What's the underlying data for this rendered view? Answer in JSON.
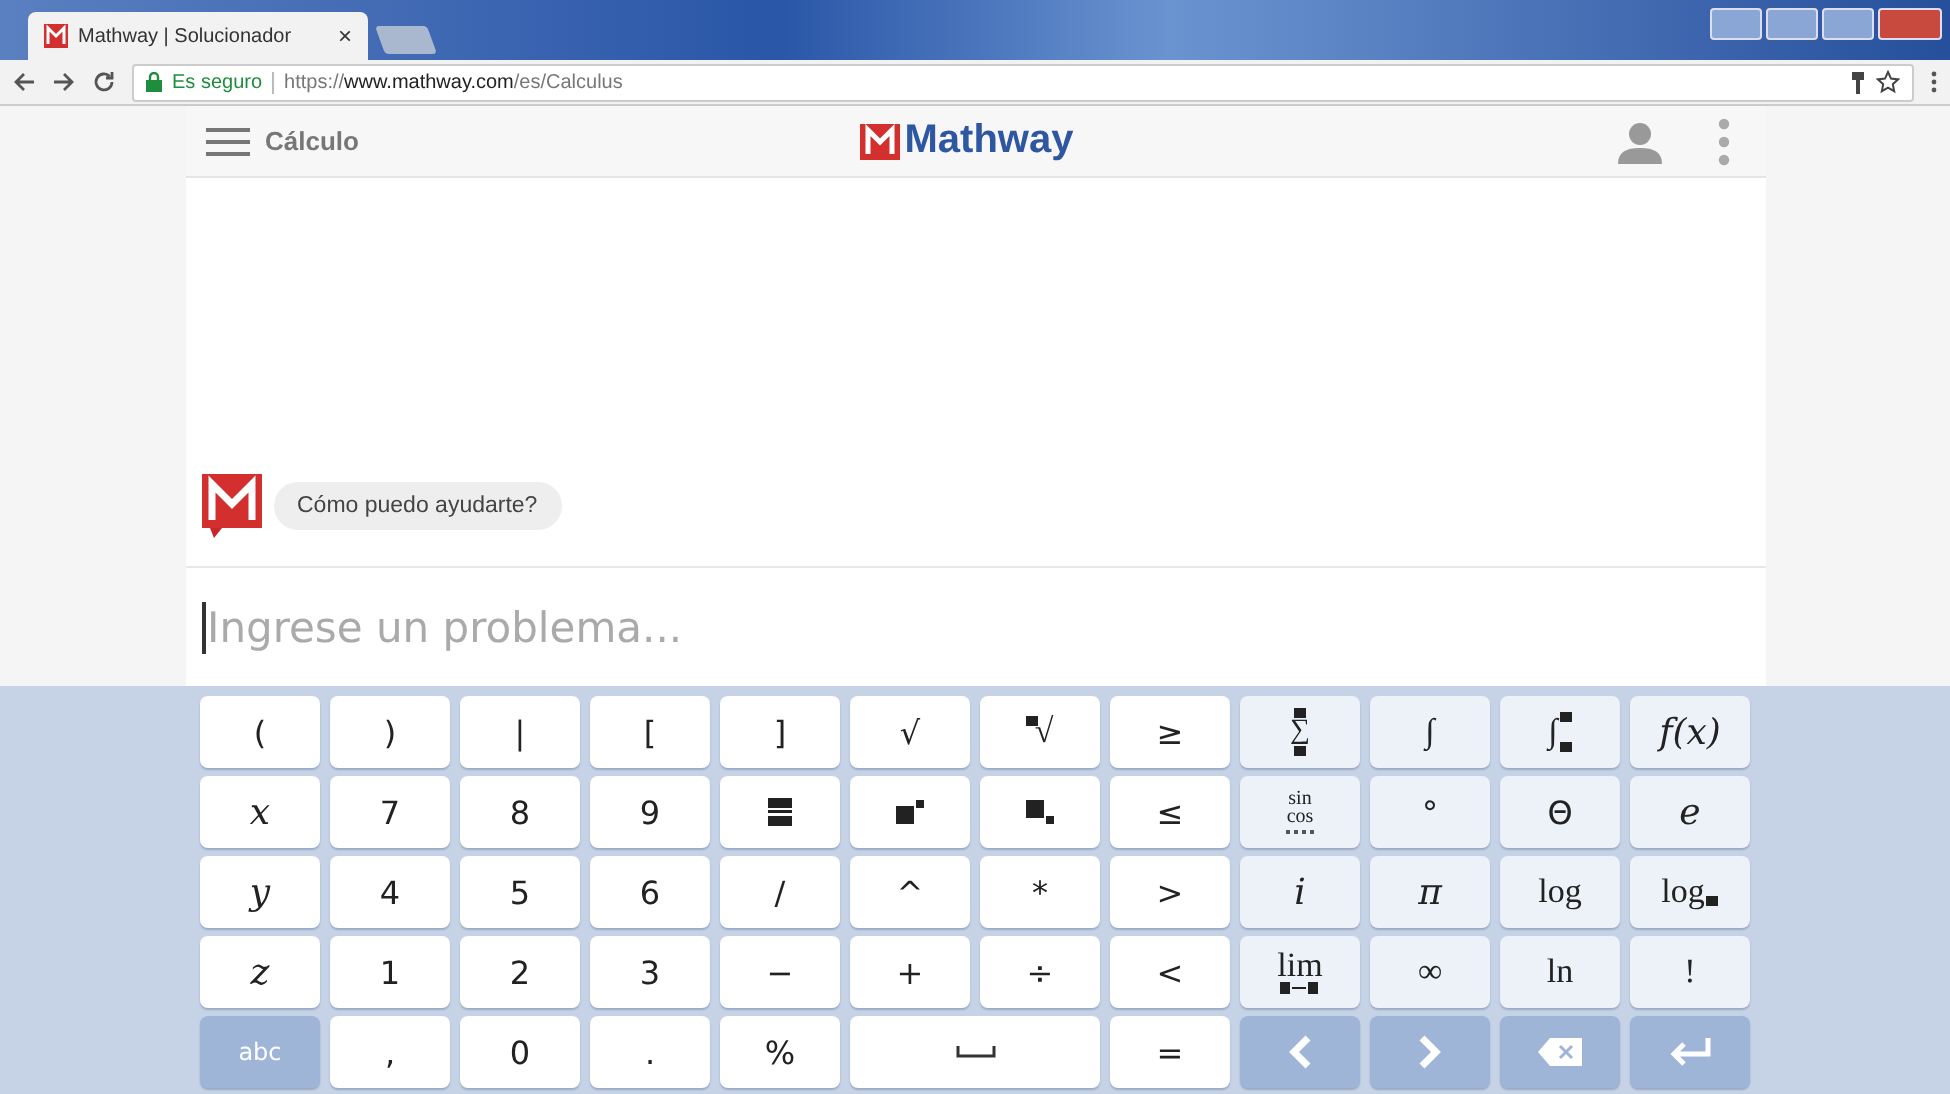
{
  "browser": {
    "tab": {
      "title": "Mathway | Solucionador",
      "close": "×"
    },
    "security": "Es seguro",
    "url": {
      "scheme": "https://",
      "host": "www.mathway.com",
      "path": "/es/Calculus"
    }
  },
  "header": {
    "section": "Cálculo",
    "logo": "Mathway"
  },
  "chat": {
    "message": "Cómo puedo ayudarte?"
  },
  "input": {
    "placeholder": "Ingrese un problema..."
  },
  "keyboard": {
    "rows": [
      [
        {
          "label": "(",
          "kind": "text",
          "shaded": false,
          "accent": false
        },
        {
          "label": ")",
          "kind": "text",
          "shaded": false,
          "accent": false
        },
        {
          "label": "|",
          "kind": "text",
          "shaded": false,
          "accent": false
        },
        {
          "label": "[",
          "kind": "text",
          "shaded": false,
          "accent": false
        },
        {
          "label": "]",
          "kind": "text",
          "shaded": false,
          "accent": false
        },
        {
          "label": "√",
          "kind": "text",
          "shaded": false,
          "accent": false
        },
        {
          "label": "√",
          "kind": "nthroot",
          "shaded": false,
          "accent": false
        },
        {
          "label": "≥",
          "kind": "text",
          "shaded": false,
          "accent": false
        },
        {
          "label": "∑",
          "kind": "sigma",
          "shaded": true,
          "accent": false
        },
        {
          "label": "∫",
          "kind": "fn",
          "shaded": true,
          "accent": false
        },
        {
          "label": "∫",
          "kind": "defint",
          "shaded": true,
          "accent": false
        },
        {
          "label": "f(x)",
          "kind": "var",
          "shaded": true,
          "accent": false
        }
      ],
      [
        {
          "label": "x",
          "kind": "var",
          "shaded": false,
          "accent": false
        },
        {
          "label": "7",
          "kind": "text",
          "shaded": false,
          "accent": false
        },
        {
          "label": "8",
          "kind": "text",
          "shaded": false,
          "accent": false
        },
        {
          "label": "9",
          "kind": "text",
          "shaded": false,
          "accent": false
        },
        {
          "kind": "fraction",
          "shaded": false,
          "accent": false
        },
        {
          "kind": "power",
          "shaded": false,
          "accent": false
        },
        {
          "kind": "subscript",
          "shaded": false,
          "accent": false
        },
        {
          "label": "≤",
          "kind": "text",
          "shaded": false,
          "accent": false
        },
        {
          "label": "sin",
          "label2": "cos",
          "kind": "trig",
          "shaded": true,
          "accent": false
        },
        {
          "label": "°",
          "kind": "text",
          "shaded": true,
          "accent": false
        },
        {
          "label": "Θ",
          "kind": "text",
          "shaded": true,
          "accent": false
        },
        {
          "label": "e",
          "kind": "var",
          "shaded": true,
          "accent": false
        }
      ],
      [
        {
          "label": "y",
          "kind": "var",
          "shaded": false,
          "accent": false
        },
        {
          "label": "4",
          "kind": "text",
          "shaded": false,
          "accent": false
        },
        {
          "label": "5",
          "kind": "text",
          "shaded": false,
          "accent": false
        },
        {
          "label": "6",
          "kind": "text",
          "shaded": false,
          "accent": false
        },
        {
          "label": "/",
          "kind": "text",
          "shaded": false,
          "accent": false
        },
        {
          "label": "^",
          "kind": "text",
          "shaded": false,
          "accent": false
        },
        {
          "label": "*",
          "kind": "text",
          "shaded": false,
          "accent": false
        },
        {
          "label": ">",
          "kind": "text",
          "shaded": false,
          "accent": false
        },
        {
          "label": "i",
          "kind": "var",
          "shaded": true,
          "accent": false
        },
        {
          "label": "π",
          "kind": "var",
          "shaded": true,
          "accent": false
        },
        {
          "label": "log",
          "kind": "fn",
          "shaded": true,
          "accent": false
        },
        {
          "label": "log",
          "kind": "logbase",
          "shaded": true,
          "accent": false
        }
      ],
      [
        {
          "label": "z",
          "kind": "var",
          "shaded": false,
          "accent": false
        },
        {
          "label": "1",
          "kind": "text",
          "shaded": false,
          "accent": false
        },
        {
          "label": "2",
          "kind": "text",
          "shaded": false,
          "accent": false
        },
        {
          "label": "3",
          "kind": "text",
          "shaded": false,
          "accent": false
        },
        {
          "label": "−",
          "kind": "text",
          "shaded": false,
          "accent": false
        },
        {
          "label": "+",
          "kind": "text",
          "shaded": false,
          "accent": false
        },
        {
          "label": "÷",
          "kind": "text",
          "shaded": false,
          "accent": false
        },
        {
          "label": "<",
          "kind": "text",
          "shaded": false,
          "accent": false
        },
        {
          "label": "lim",
          "kind": "limit",
          "shaded": true,
          "accent": false
        },
        {
          "label": "∞",
          "kind": "fn",
          "shaded": true,
          "accent": false
        },
        {
          "label": "ln",
          "kind": "fn",
          "shaded": true,
          "accent": false
        },
        {
          "label": "!",
          "kind": "fn",
          "shaded": true,
          "accent": false
        }
      ]
    ],
    "bottom_row": [
      {
        "label": "abc",
        "kind": "text",
        "shaded": false,
        "accent": true
      },
      {
        "label": ",",
        "kind": "text",
        "shaded": false,
        "accent": false
      },
      {
        "label": "0",
        "kind": "text",
        "shaded": false,
        "accent": false
      },
      {
        "label": ".",
        "kind": "text",
        "shaded": false,
        "accent": false
      },
      {
        "label": "%",
        "kind": "text",
        "shaded": false,
        "accent": false
      },
      {
        "kind": "space",
        "shaded": false,
        "accent": false
      },
      {
        "label": "=",
        "kind": "text",
        "shaded": false,
        "accent": false
      },
      {
        "kind": "left",
        "shaded": false,
        "accent": true
      },
      {
        "kind": "right",
        "shaded": false,
        "accent": true
      },
      {
        "kind": "backspace",
        "shaded": false,
        "accent": true
      },
      {
        "kind": "enter",
        "shaded": false,
        "accent": true
      }
    ]
  }
}
